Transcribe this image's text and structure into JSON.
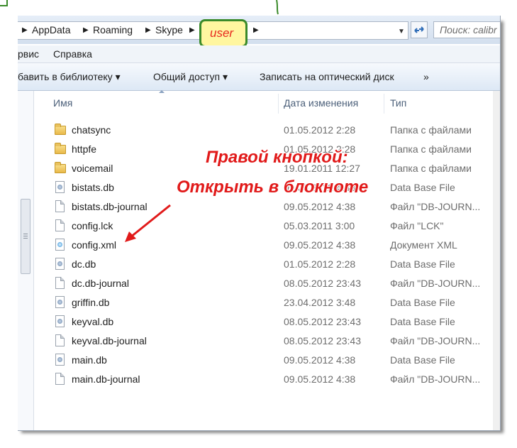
{
  "address": {
    "crumbs": [
      "AppData",
      "Roaming",
      "Skype"
    ],
    "current": "user",
    "search_placeholder": "Поиск: calibr"
  },
  "menu": [
    "рвис",
    "Справка"
  ],
  "toolbar": [
    "бавить в библиотеку ▾",
    "Общий доступ ▾",
    "Записать на оптический диск",
    "»"
  ],
  "columns": {
    "name": "Имя",
    "date": "Дата изменения",
    "type": "Тип"
  },
  "files": [
    {
      "name": "chatsync",
      "date": "01.05.2012 2:28",
      "type": "Папка с файлами",
      "icon": "folder-icon"
    },
    {
      "name": "httpfe",
      "date": "01.05.2012 2:28",
      "type": "Папка с файлами",
      "icon": "folder-icon"
    },
    {
      "name": "voicemail",
      "date": "19.01.2011 12:27",
      "type": "Папка с файлами",
      "icon": "folder-icon"
    },
    {
      "name": "bistats.db",
      "date": "09.05.2012 4:38",
      "type": "Data Base File",
      "icon": "database-file-icon"
    },
    {
      "name": "bistats.db-journal",
      "date": "09.05.2012 4:38",
      "type": "Файл \"DB-JOURN...",
      "icon": "file-icon"
    },
    {
      "name": "config.lck",
      "date": "05.03.2011 3:00",
      "type": "Файл \"LCK\"",
      "icon": "file-icon"
    },
    {
      "name": "config.xml",
      "date": "09.05.2012 4:38",
      "type": "Документ XML",
      "icon": "xml-file-icon"
    },
    {
      "name": "dc.db",
      "date": "01.05.2012 2:28",
      "type": "Data Base File",
      "icon": "database-file-icon"
    },
    {
      "name": "dc.db-journal",
      "date": "08.05.2012 23:43",
      "type": "Файл \"DB-JOURN...",
      "icon": "file-icon"
    },
    {
      "name": "griffin.db",
      "date": "23.04.2012 3:48",
      "type": "Data Base File",
      "icon": "database-file-icon"
    },
    {
      "name": "keyval.db",
      "date": "08.05.2012 23:43",
      "type": "Data Base File",
      "icon": "database-file-icon"
    },
    {
      "name": "keyval.db-journal",
      "date": "08.05.2012 23:43",
      "type": "Файл \"DB-JOURN...",
      "icon": "file-icon"
    },
    {
      "name": "main.db",
      "date": "09.05.2012 4:38",
      "type": "Data Base File",
      "icon": "database-file-icon"
    },
    {
      "name": "main.db-journal",
      "date": "09.05.2012 4:38",
      "type": "Файл \"DB-JOURN...",
      "icon": "file-icon"
    }
  ],
  "annotation": {
    "line1": "Правой кнопкой:",
    "line2": "Открыть в блокноте"
  },
  "colors": {
    "annotation": "#e11a1a",
    "highlight_fill": "#fff6a0",
    "highlight_border": "#3a8a2a"
  }
}
